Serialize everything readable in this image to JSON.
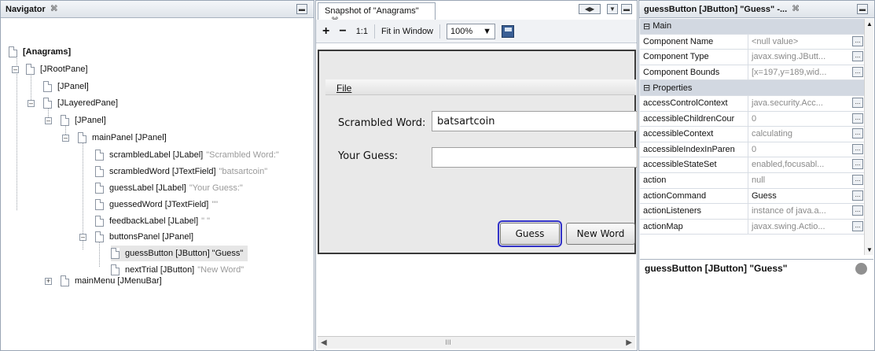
{
  "navigator": {
    "title": "Navigator",
    "close_glyph": "⌘",
    "rows": [
      {
        "label": "[Anagrams]",
        "extra": ""
      },
      {
        "label": "[JRootPane]",
        "extra": ""
      },
      {
        "label": "[JPanel]",
        "extra": ""
      },
      {
        "label": "[JLayeredPane]",
        "extra": ""
      },
      {
        "label": "[JPanel]",
        "extra": ""
      },
      {
        "label": "mainPanel [JPanel]",
        "extra": ""
      },
      {
        "label": "scrambledLabel [JLabel]",
        "extra": "\"Scrambled Word:\""
      },
      {
        "label": "scrambledWord [JTextField]",
        "extra": "\"batsartcoin\""
      },
      {
        "label": "guessLabel [JLabel]",
        "extra": "\"Your Guess:\""
      },
      {
        "label": "guessedWord [JTextField]",
        "extra": "\"\""
      },
      {
        "label": "feedbackLabel [JLabel]",
        "extra": "\" \""
      },
      {
        "label": "buttonsPanel [JPanel]",
        "extra": ""
      },
      {
        "label": "guessButton [JButton] \"Guess\"",
        "extra": ""
      },
      {
        "label": "nextTrial [JButton]",
        "extra": "\"New Word\""
      },
      {
        "label": "mainMenu [JMenuBar]",
        "extra": ""
      }
    ]
  },
  "snapshot": {
    "tab_title": "Snapshot of \"Anagrams\"",
    "toolbar": {
      "zoom_in": "+",
      "zoom_out": "−",
      "actual_size": "1:1",
      "fit_window": "Fit in Window",
      "zoom_value": "100%"
    },
    "form": {
      "menu": "File",
      "scrambled_label": "Scrambled Word:",
      "scrambled_value": "batsartcoin",
      "guess_label": "Your Guess:",
      "guess_value": "",
      "guess_button": "Guess",
      "new_word_button": "New Word"
    },
    "scroll_thumb": "III"
  },
  "properties": {
    "title": "guessButton [JButton] \"Guess\" -...",
    "section_main": "Main",
    "section_properties": "Properties",
    "main_rows": [
      {
        "name": "Component Name",
        "value": "<null value>"
      },
      {
        "name": "Component Type",
        "value": "javax.swing.JButt..."
      },
      {
        "name": "Component Bounds",
        "value": "[x=197,y=189,wid..."
      }
    ],
    "prop_rows": [
      {
        "name": "accessControlContext",
        "value": "java.security.Acc..."
      },
      {
        "name": "accessibleChildrenCour",
        "value": "0"
      },
      {
        "name": "accessibleContext",
        "value": "calculating"
      },
      {
        "name": "accessibleIndexInParen",
        "value": "0"
      },
      {
        "name": "accessibleStateSet",
        "value": "enabled,focusabl..."
      },
      {
        "name": "action",
        "value": "null"
      },
      {
        "name": "actionCommand",
        "value": "Guess"
      },
      {
        "name": "actionListeners",
        "value": "instance of java.a..."
      },
      {
        "name": "actionMap",
        "value": "javax.swing.Actio..."
      }
    ],
    "description": "guessButton [JButton] \"Guess\""
  }
}
